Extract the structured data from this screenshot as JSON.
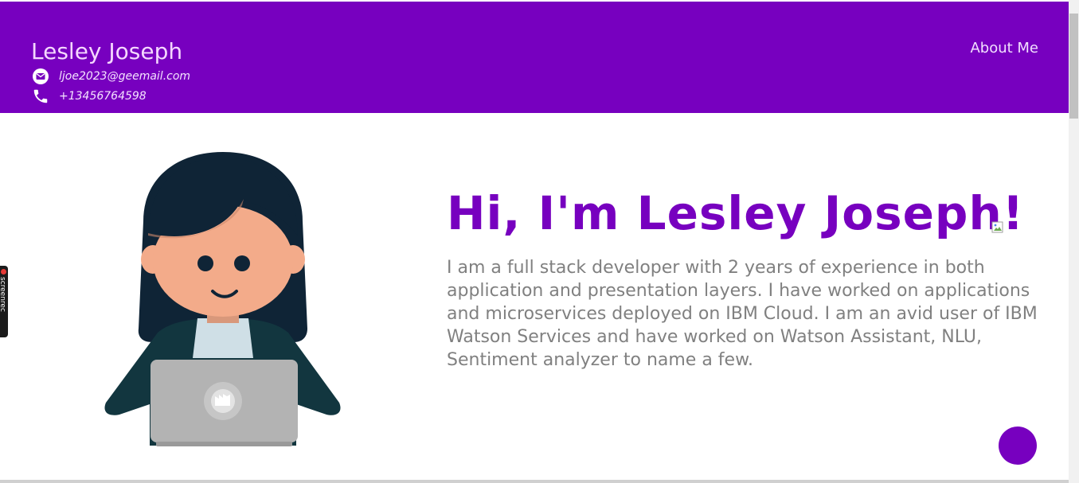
{
  "header": {
    "name": "Lesley Joseph",
    "email": "ljoe2023@geemail.com",
    "phone": "+13456764598",
    "nav": {
      "about": "About Me"
    }
  },
  "hero": {
    "title": "Hi, I'm Lesley Joseph!",
    "description": "I am a full stack developer with 2 years of experience in both application and presentation layers. I have worked on applications and microservices deployed on IBM Cloud. I am an avid user of IBM Watson Services and have worked on Watson Assistant, NLU, Sentiment analyzer to name a few."
  },
  "widgets": {
    "screenrec_label": "screenrec"
  },
  "colors": {
    "brand": "#7700bf",
    "header_text": "#f5d7ff",
    "body_text": "#808080"
  },
  "icons": {
    "email": "envelope-circle-icon",
    "phone": "phone-icon"
  }
}
